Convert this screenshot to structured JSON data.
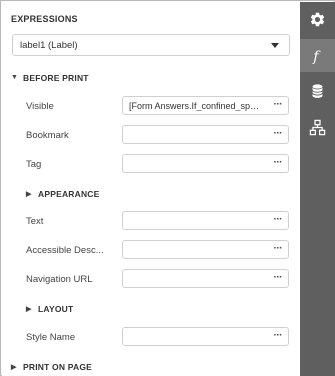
{
  "panel": {
    "title": "EXPRESSIONS",
    "selector_value": "label1 (Label)"
  },
  "groups": {
    "before_print": "BEFORE PRINT",
    "appearance": "APPEARANCE",
    "layout": "LAYOUT",
    "print_on_page": "PRINT ON PAGE"
  },
  "properties": {
    "visible": {
      "label": "Visible",
      "value": "[Form Answers.If_confined_space_entry]"
    },
    "bookmark": {
      "label": "Bookmark",
      "value": ""
    },
    "tag": {
      "label": "Tag",
      "value": ""
    },
    "text": {
      "label": "Text",
      "value": ""
    },
    "accessible_description": {
      "label": "Accessible Desc...",
      "value": ""
    },
    "navigation_url": {
      "label": "Navigation URL",
      "value": ""
    },
    "style_name": {
      "label": "Style Name",
      "value": ""
    }
  },
  "editor_button": "···",
  "toolbar": {
    "items": [
      {
        "icon": "gear-icon",
        "active": false
      },
      {
        "icon": "function-icon",
        "active": true
      },
      {
        "icon": "database-icon",
        "active": false
      },
      {
        "icon": "hierarchy-icon",
        "active": false
      }
    ]
  },
  "colors": {
    "toolbar_bg": "#5f5f5f",
    "toolbar_active": "#7a7a7a",
    "border": "#cfcfcf"
  }
}
